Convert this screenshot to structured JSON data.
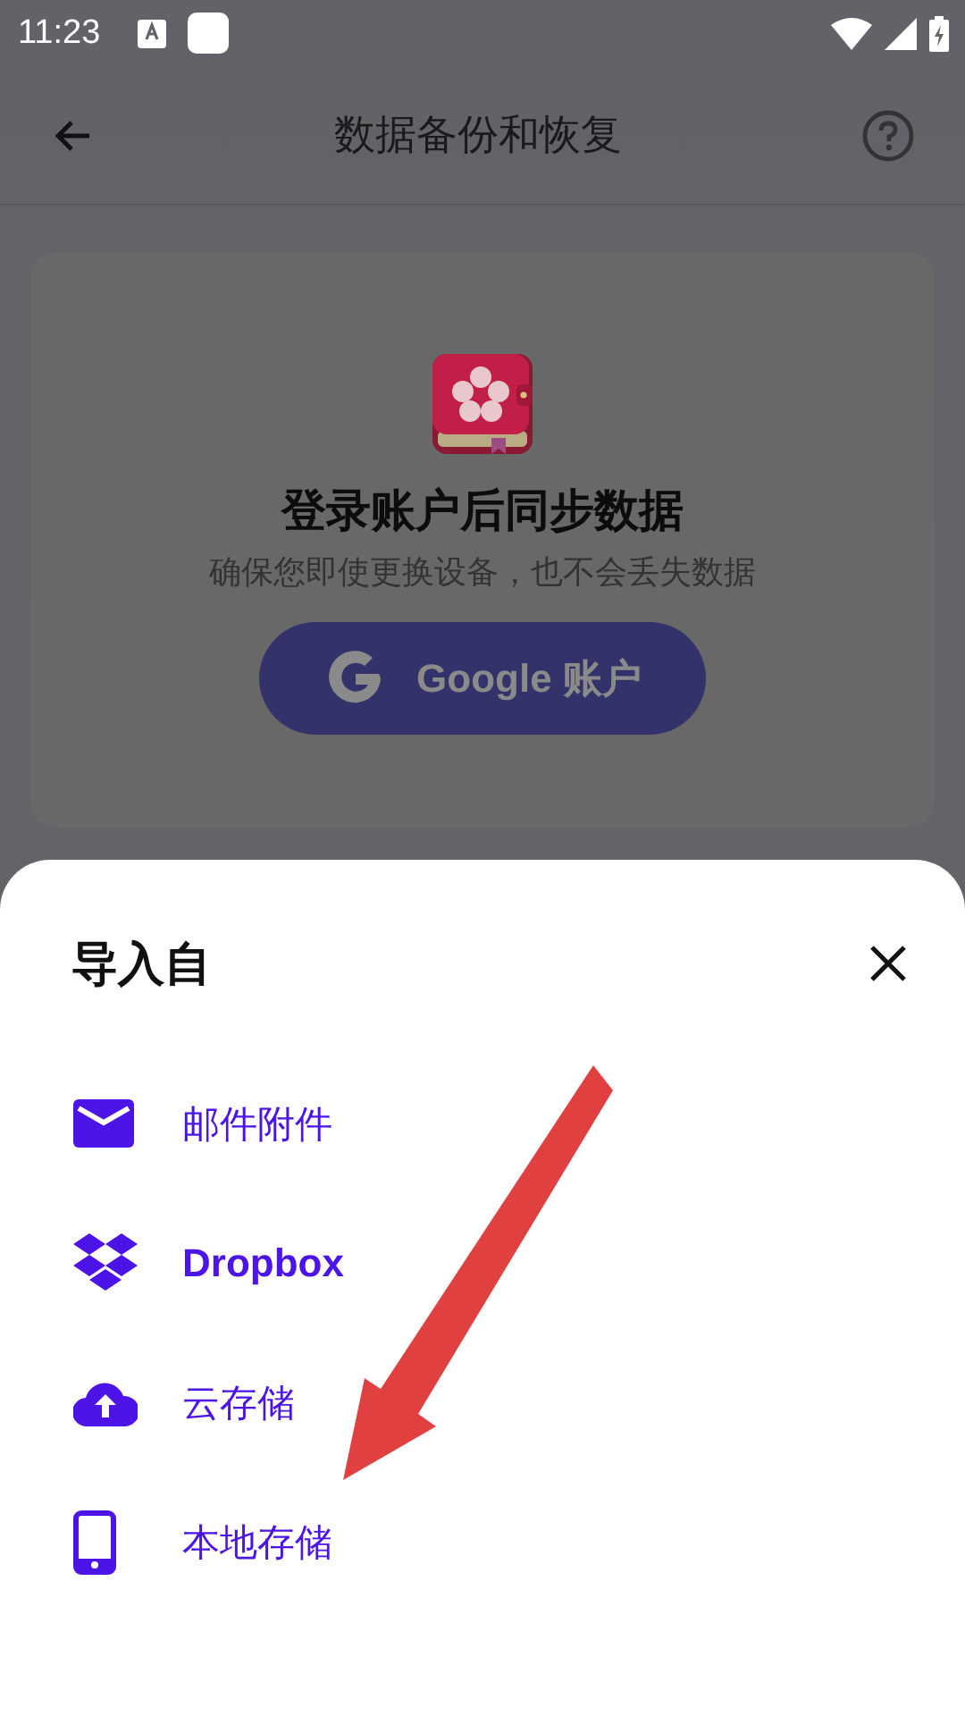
{
  "status_bar": {
    "time": "11:23"
  },
  "app_bar": {
    "title": "数据备份和恢复"
  },
  "card": {
    "heading": "登录账户后同步数据",
    "subtitle": "确保您即使更换设备，也不会丢失数据",
    "button": "Google 账户"
  },
  "sheet": {
    "title": "导入自",
    "items": [
      {
        "kind": "mail",
        "label": "邮件附件"
      },
      {
        "kind": "dropbox",
        "label": "Dropbox"
      },
      {
        "kind": "cloud",
        "label": "云存储"
      },
      {
        "kind": "phone",
        "label": "本地存储"
      }
    ]
  }
}
